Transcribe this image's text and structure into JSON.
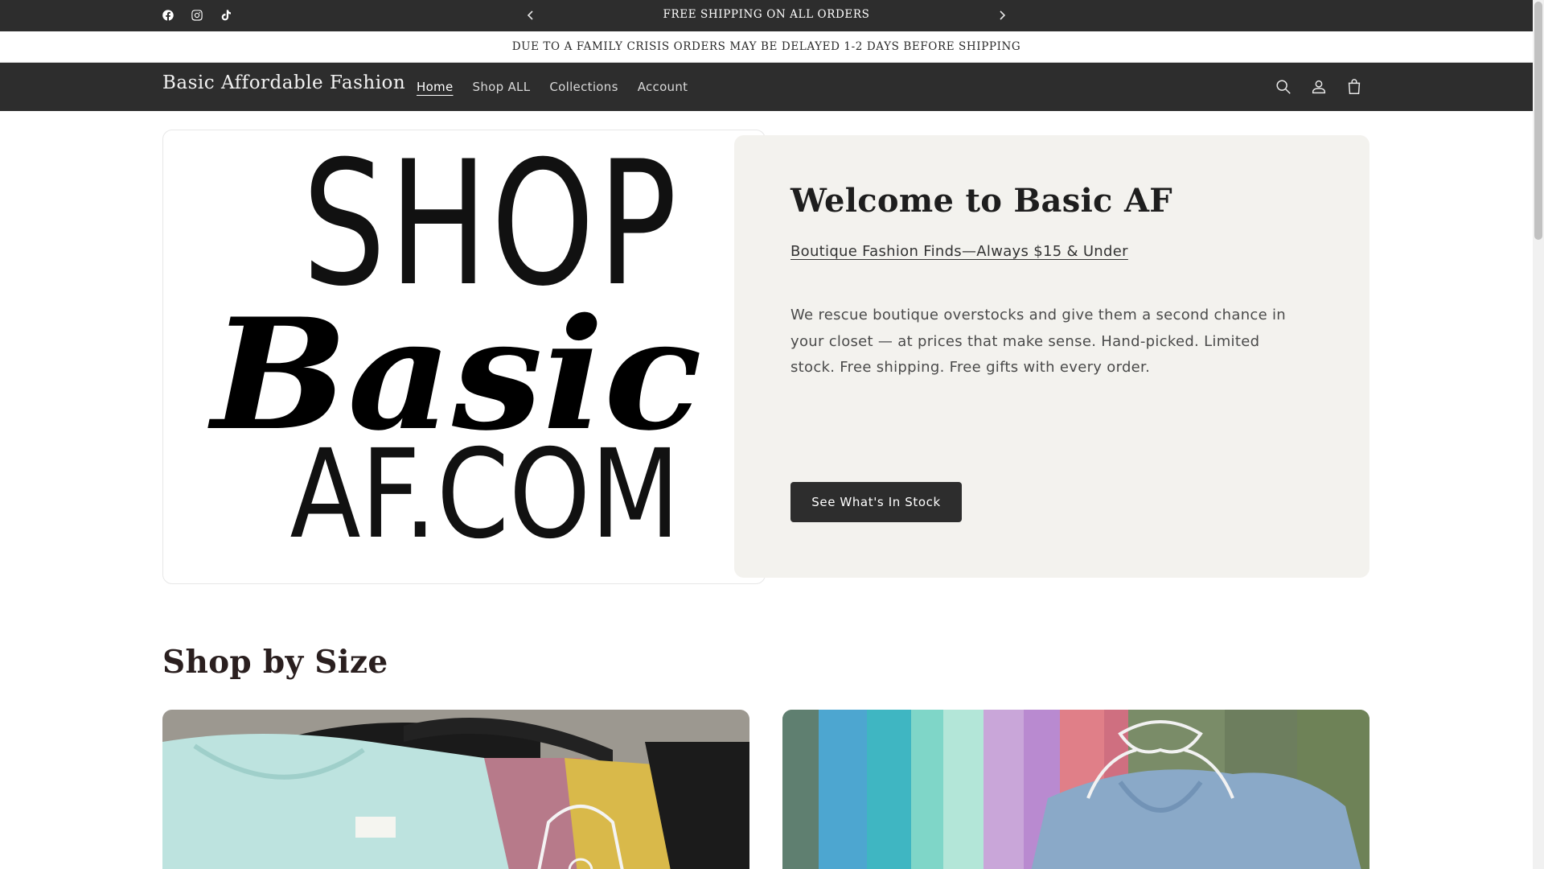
{
  "announcement": {
    "social_icons": [
      "facebook-icon",
      "instagram-icon",
      "tiktok-icon"
    ],
    "text": "FREE SHIPPING ON ALL ORDERS",
    "prev_icon": "chevron-left-icon",
    "next_icon": "chevron-right-icon"
  },
  "notice": {
    "text": "DUE TO A FAMILY CRISIS ORDERS MAY BE DELAYED 1-2 DAYS BEFORE SHIPPING"
  },
  "header": {
    "logo": "Basic Affordable Fashion",
    "nav": [
      {
        "label": "Home",
        "active": true
      },
      {
        "label": "Shop ALL",
        "active": false
      },
      {
        "label": "Collections",
        "active": false
      },
      {
        "label": "Account",
        "active": false
      }
    ],
    "icons": [
      "search-icon",
      "account-icon",
      "cart-icon"
    ]
  },
  "hero": {
    "image_alt": "SHOP Basic AF.COM",
    "image_lines": [
      "SHOP",
      "Basic",
      "AF.COM"
    ],
    "title": "Welcome to Basic AF",
    "link": "Boutique Fashion Finds—Always $15 & Under",
    "text": "We rescue boutique overstocks and give them a second chance in your closet — at prices that make sense. Hand-picked. Limited stock. Free shipping. Free gifts with every order.",
    "button": "See What's In Stock"
  },
  "shop_by_size": {
    "title": "Shop by Size"
  },
  "colors": {
    "dark_bar": "#2d2d2d",
    "hero_card_bg": "#f3f2ee",
    "button_bg": "#2d2d2d"
  }
}
